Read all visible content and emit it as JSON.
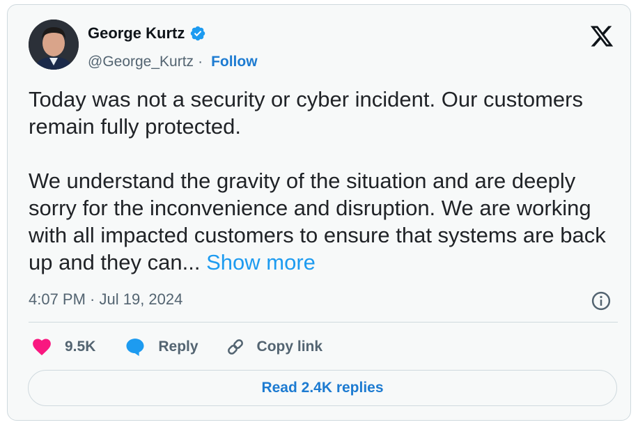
{
  "author": {
    "name": "George Kurtz",
    "handle": "@George_Kurtz",
    "separator": "·",
    "follow_label": "Follow",
    "verified": true,
    "verified_color": "#1d9bf0"
  },
  "icons": {
    "brand": "x-logo-icon",
    "verified": "verified-badge-icon",
    "info": "info-icon",
    "like": "heart-icon",
    "reply": "reply-bubble-icon",
    "copy_link": "link-icon"
  },
  "tweet": {
    "paragraph_1": "Today was not a security or cyber incident. Our customers remain fully protected.",
    "paragraph_2": "We understand the gravity of the situation and are deeply sorry for the inconvenience and disruption. We are working with all impacted customers to ensure that systems are back up and they can...",
    "show_more_label": "Show more",
    "timestamp": "4:07 PM · Jul 19, 2024"
  },
  "actions": {
    "like_count": "9.5K",
    "like_color": "#f91880",
    "reply_label": "Reply",
    "reply_color": "#1d9bf0",
    "copy_link_label": "Copy link"
  },
  "read_replies_label": "Read 2.4K replies"
}
